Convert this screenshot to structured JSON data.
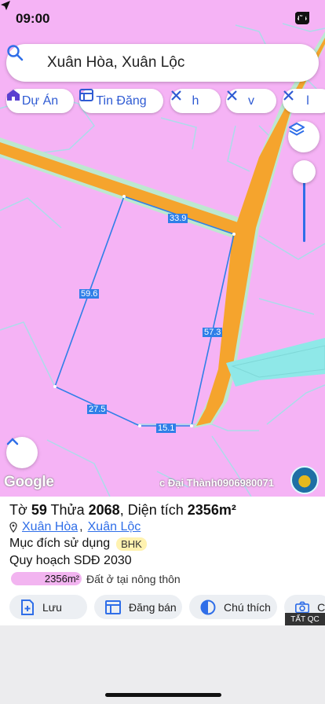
{
  "status_bar": {
    "time": "09:00",
    "battery": "83"
  },
  "search": {
    "query": "Xuân Hòa, Xuân Lộc"
  },
  "chips": [
    {
      "label": "Dự Án",
      "icon": "house-icon"
    },
    {
      "label": "Tin Đăng",
      "icon": "list-icon"
    },
    {
      "label": "h",
      "icon": "tools-icon"
    },
    {
      "label": "v",
      "icon": "tools-icon"
    },
    {
      "label": "l",
      "icon": "tools-icon"
    }
  ],
  "map": {
    "edge_labels": [
      "33.9",
      "59.6",
      "57.3",
      "27.5",
      "15.1"
    ],
    "google_label": "Google",
    "attribution": "c Đại Thành0906980071",
    "colors": {
      "land": "#f5b3f5",
      "road": "#f5a42d",
      "water": "#8fe8e8",
      "parcel_line": "#2f7fe8"
    }
  },
  "parcel": {
    "to_label": "Tờ",
    "to_value": "59",
    "thua_label": "Thửa",
    "thua_value": "2068",
    "area_label": "Diện tích",
    "area_value": "2356m²",
    "location_commune": "Xuân Hòa",
    "location_district": "Xuân Lộc",
    "purpose_label": "Mục đích sử dụng",
    "purpose_code": "BHK",
    "planning_label": "Quy hoạch SDĐ 2030",
    "planning_area": "2356m²",
    "planning_use": "Đất ở tại nông thôn"
  },
  "actions": [
    {
      "label": "Lưu",
      "icon": "save-add-icon"
    },
    {
      "label": "Đăng bán",
      "icon": "calendar-icon"
    },
    {
      "label": "Chú thích",
      "icon": "legend-icon"
    },
    {
      "label": "Ch",
      "icon": "camera-icon"
    }
  ],
  "ad_label": "TẤT QC"
}
